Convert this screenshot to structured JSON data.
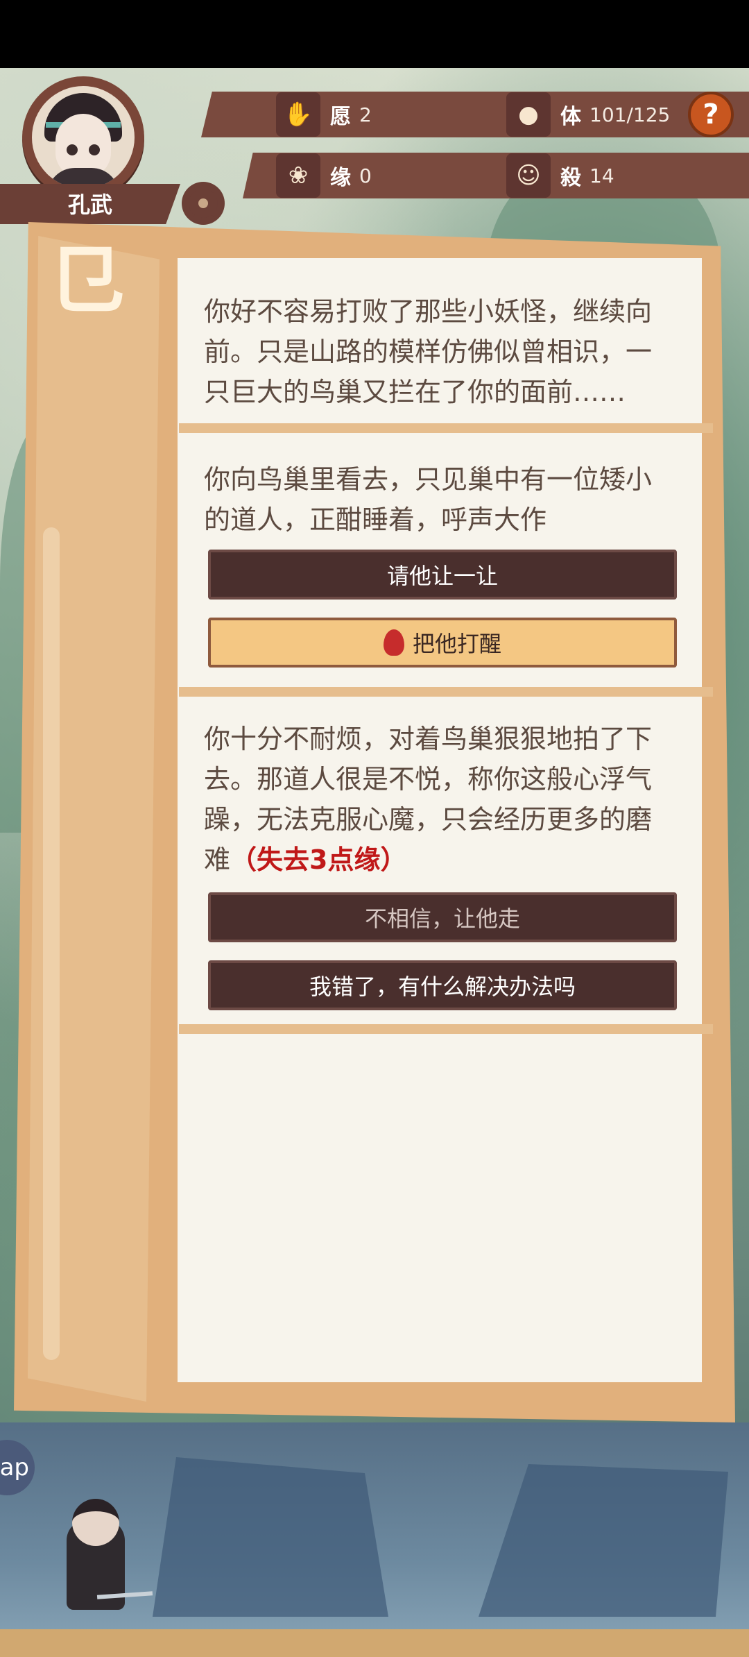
{
  "character": {
    "name": "孔武"
  },
  "stats": {
    "wish": {
      "label": "愿",
      "value": "2",
      "icon": "hand-icon"
    },
    "body": {
      "label": "体",
      "value": "101/125",
      "icon": "bun-icon"
    },
    "fate": {
      "label": "缘",
      "value": "0",
      "icon": "lotus-icon"
    },
    "kill": {
      "label": "殺",
      "value": "14",
      "icon": "buddha-icon"
    }
  },
  "help_label": "?",
  "panel_glyph": "⺋",
  "story": {
    "p1": "你好不容易打败了那些小妖怪，继续向前。只是山路的模样仿佛似曾相识，一只巨大的鸟巢又拦在了你的面前……",
    "p2": "你向鸟巢里看去，只见巢中有一位矮小的道人，正酣睡着，呼声大作",
    "choice1": "请他让一让",
    "choice2": "把他打醒",
    "p3": "你十分不耐烦，对着鸟巢狠狠地拍了下去。那道人很是不悦，称你这般心浮气躁，无法克服心魔，只会经历更多的磨难",
    "p3_loss": "（失去3点缘）",
    "choice3": "不相信，让他走",
    "choice4": "我错了，有什么解决办法吗"
  },
  "side_pill_label": "ap"
}
